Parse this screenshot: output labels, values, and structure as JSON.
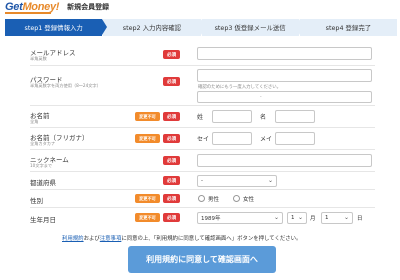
{
  "header": {
    "logo_part1": "Get",
    "logo_part2": "Money!",
    "title": "新規会員登録"
  },
  "steps": [
    {
      "label": "step1  登録情報入力",
      "active": true
    },
    {
      "label": "step2  入力内容確認",
      "active": false
    },
    {
      "label": "step3  仮登録メール送信",
      "active": false
    },
    {
      "label": "step4  登録完了",
      "active": false
    }
  ],
  "badges": {
    "required": "必須",
    "unchangeable": "変更不可"
  },
  "form": {
    "email": {
      "label": "メールアドレス",
      "sub": "半角英数"
    },
    "password": {
      "label": "パスワード",
      "sub": "半角英数字を両方使用（8～24文字）",
      "confirm_hint": "確認のためにもう一度入力してください。",
      "strength": "-"
    },
    "name": {
      "label": "お名前",
      "sub": "全角",
      "last": "姓",
      "first": "名"
    },
    "kana": {
      "label": "お名前（フリガナ）",
      "sub": "全角カタカナ",
      "last": "セイ",
      "first": "メイ"
    },
    "nickname": {
      "label": "ニックネーム",
      "sub": "10文字まで"
    },
    "prefecture": {
      "label": "都道府県",
      "value": "-"
    },
    "gender": {
      "label": "性別",
      "male": "男性",
      "female": "女性"
    },
    "birthday": {
      "label": "生年月日",
      "year": "1989年",
      "month": "1",
      "day": "1",
      "month_unit": "月",
      "day_unit": "日"
    }
  },
  "agreement": {
    "link1": "利用規約",
    "and": "および",
    "link2": "注意事項",
    "text": "に同意の上、「利用規約に同意して確認画面へ」ボタンを押してください。"
  },
  "submit_label": "利用規約に同意して確認画面へ"
}
